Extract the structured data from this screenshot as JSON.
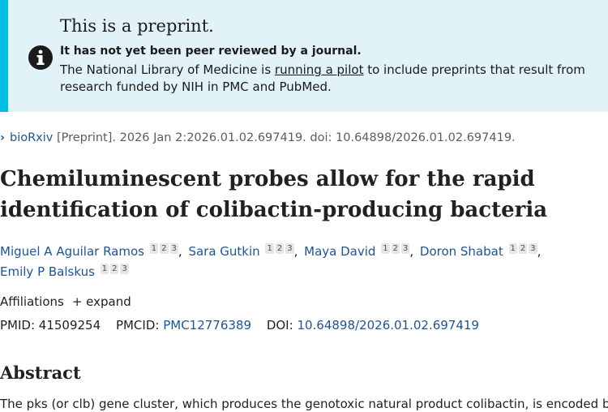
{
  "banner": {
    "title": "This is a preprint.",
    "strong": "It has not yet been peer reviewed by a journal.",
    "text_before": "The National Library of Medicine is ",
    "link": "running a pilot",
    "text_after": " to include preprints that result from research funded by NIH in PMC and PubMed.",
    "icon": "info-icon"
  },
  "citation": {
    "source": "bioRxiv",
    "details": " [Preprint]. 2026 Jan 2:2026.01.02.697419. doi: 10.64898/2026.01.02.697419."
  },
  "title": "Chemiluminescent probes allow for the rapid identification of colibactin-producing bacteria",
  "authors": [
    {
      "name": "Miguel A Aguilar Ramos",
      "affs": [
        "1",
        "2",
        "3"
      ]
    },
    {
      "name": "Sara Gutkin",
      "affs": [
        "1",
        "2",
        "3"
      ]
    },
    {
      "name": "Maya David",
      "affs": [
        "1",
        "2",
        "3"
      ]
    },
    {
      "name": "Doron Shabat",
      "affs": [
        "1",
        "2",
        "3"
      ]
    },
    {
      "name": "Emily P Balskus",
      "affs": [
        "1",
        "2",
        "3"
      ]
    }
  ],
  "affiliations": {
    "label": "Affiliations",
    "expand": "+ expand"
  },
  "ids": {
    "pmid_label": "PMID:",
    "pmid": "41509254",
    "pmcid_label": "PMCID:",
    "pmcid": "PMC12776389",
    "doi_label": "DOI:",
    "doi": "10.64898/2026.01.02.697419"
  },
  "abstract": {
    "heading": "Abstract",
    "text": "The pks (or clb) gene cluster, which produces the genotoxic natural product colibactin, is encoded by"
  },
  "colors": {
    "link": "#205493",
    "banner_bg": "#e1f3f8",
    "banner_accent": "#00bde3"
  }
}
